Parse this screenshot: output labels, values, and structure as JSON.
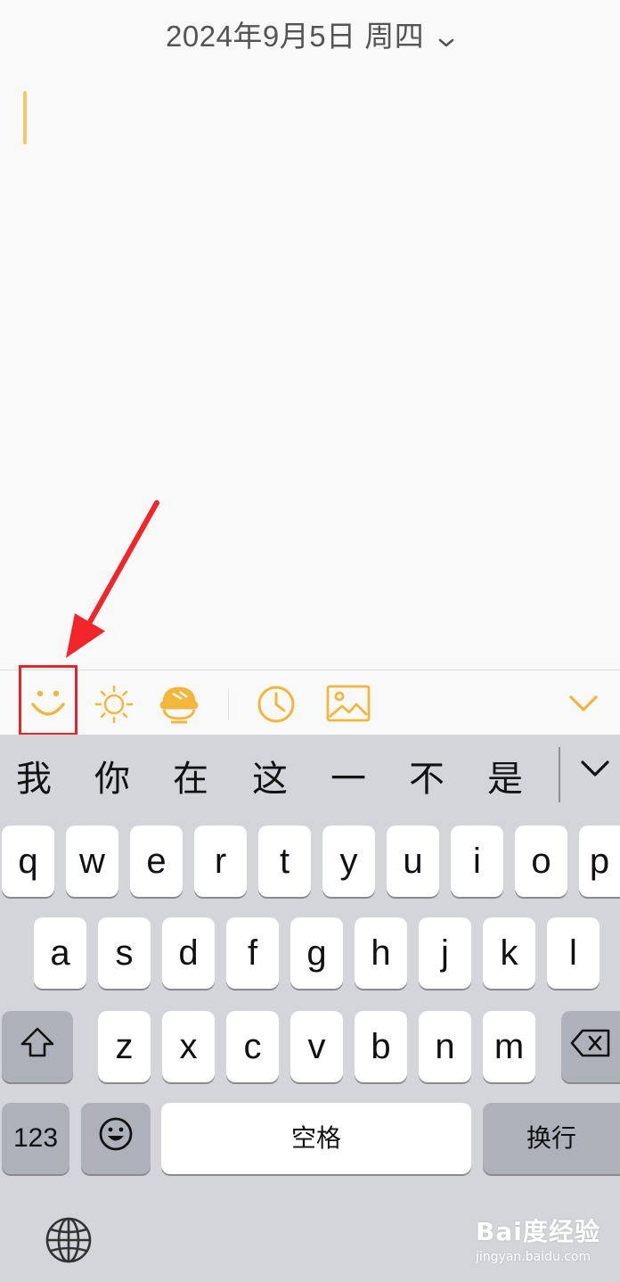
{
  "header": {
    "date_label": "2024年9月5日 周四"
  },
  "toolbar": {
    "icons": [
      "smile-icon",
      "sun-icon",
      "food-bowl-icon",
      "clock-icon",
      "image-icon",
      "chevron-down-icon"
    ],
    "accent_color": "#f2b63c"
  },
  "annotation": {
    "highlight_color": "#e0272b"
  },
  "keyboard": {
    "candidates": [
      "我",
      "你",
      "在",
      "这",
      "一",
      "不",
      "是"
    ],
    "row1": [
      "q",
      "w",
      "e",
      "r",
      "t",
      "y",
      "u",
      "i",
      "o",
      "p"
    ],
    "row2": [
      "a",
      "s",
      "d",
      "f",
      "g",
      "h",
      "j",
      "k",
      "l"
    ],
    "row3": [
      "z",
      "x",
      "c",
      "v",
      "b",
      "n",
      "m"
    ],
    "numbers_label": "123",
    "space_label": "空格",
    "return_label": "换行"
  },
  "watermark": {
    "brand": "Bai度经验",
    "site": "jingyan.baidu.com"
  }
}
